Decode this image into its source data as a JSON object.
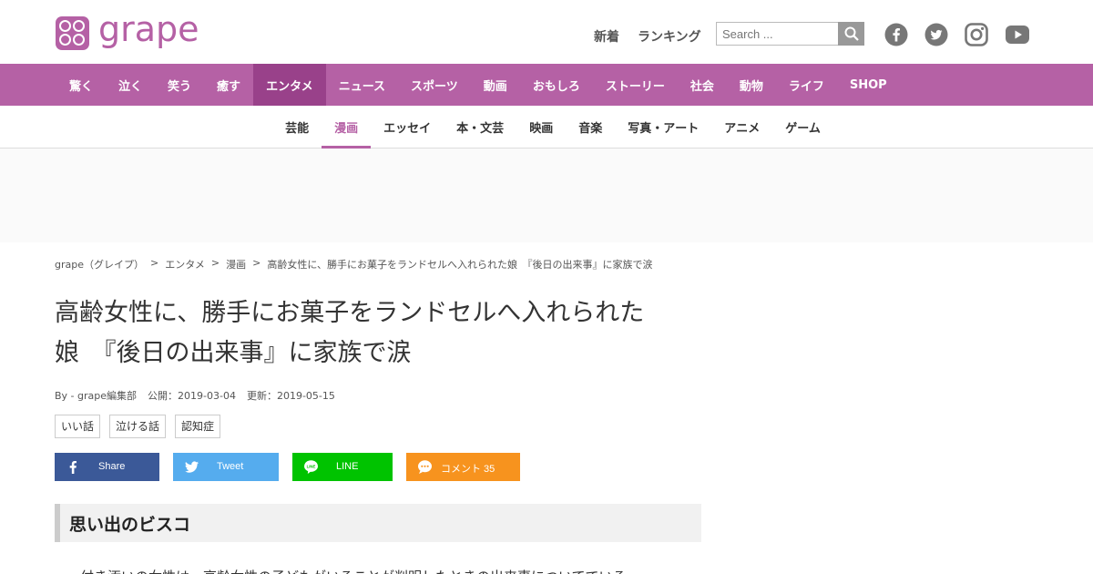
{
  "header": {
    "logo_text": "grape",
    "top_links": [
      "新着",
      "ランキング"
    ],
    "search_placeholder": "Search ...",
    "social": [
      "facebook-icon",
      "twitter-icon",
      "instagram-icon",
      "youtube-icon"
    ]
  },
  "mainnav": {
    "items": [
      "驚く",
      "泣く",
      "笑う",
      "癒す",
      "エンタメ",
      "ニュース",
      "スポーツ",
      "動画",
      "おもしろ",
      "ストーリー",
      "社会",
      "動物",
      "ライフ",
      "SHOP"
    ],
    "active": "エンタメ"
  },
  "subnav": {
    "items": [
      "芸能",
      "漫画",
      "エッセイ",
      "本・文芸",
      "映画",
      "音楽",
      "写真・アート",
      "アニメ",
      "ゲーム"
    ],
    "active": "漫画"
  },
  "breadcrumb": {
    "items": [
      "grape（グレイプ）",
      "エンタメ",
      "漫画",
      "高齢女性に、勝手にお菓子をランドセルへ入れられた娘　『後日の出来事』に家族で涙"
    ],
    "sep": ">"
  },
  "article": {
    "title_line1": "高齢女性に、勝手にお菓子をランドセルへ入れられた",
    "title_line2": "娘　『後日の出来事』に家族で涙",
    "author": "By - grape編集部",
    "published": "公開：2019-03-04",
    "updated": "更新：2019-05-15",
    "tags": [
      "いい話",
      "泣ける話",
      "認知症"
    ],
    "share": {
      "facebook": "Share",
      "twitter": "Tweet",
      "line": "LINE",
      "comment": "コメント 35"
    },
    "section_heading": "思い出のビスコ",
    "body_start": "付き添いの女性は、高齢女性の子どもがいることが判明したときの出来事についてでいる"
  },
  "colors": {
    "brand": "#b561a5",
    "brand_active": "#99418a",
    "facebook": "#3b5998",
    "twitter": "#55acee",
    "line": "#00c300",
    "comment": "#f7931e"
  }
}
